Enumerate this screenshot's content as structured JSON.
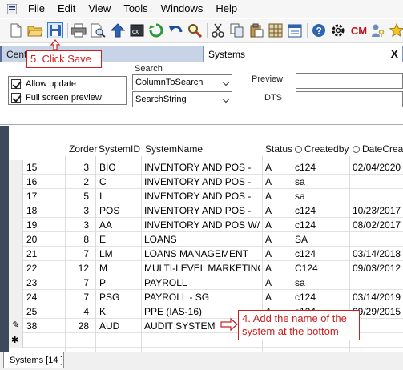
{
  "menu": {
    "items": [
      "File",
      "Edit",
      "View",
      "Tools",
      "Windows",
      "Help"
    ]
  },
  "toolbar": {
    "icons": [
      "new-file-icon",
      "open-folder-icon",
      "save-icon",
      "print-icon",
      "print-preview-icon",
      "upload-arrow-icon",
      "command-icon",
      "refresh-icon",
      "undo-icon",
      "search-zoom-icon",
      "cut-icon",
      "copy-icon",
      "paste-icon",
      "grid-icon",
      "calendar-icon",
      "help-icon",
      "settings-gear-icon",
      "cm-icon",
      "user-key-icon",
      "star-icon"
    ],
    "cm_label": "CM"
  },
  "tabs": {
    "central": "Centra",
    "systems": "Systems",
    "close_glyph": "X"
  },
  "filters": {
    "allow_update_label": "Allow update",
    "full_screen_preview_label": "Full screen preview",
    "search_label": "Search",
    "column_to_search": "ColumnToSearch",
    "search_string": "SearchString",
    "preview_label": "Preview",
    "dts_label": "DTS"
  },
  "grid": {
    "columns": [
      "Zorder",
      "SystemID",
      "SystemName",
      "Status",
      "Createdby",
      "DateCreate"
    ],
    "rows": [
      {
        "id": "15",
        "zorder": "3",
        "systemid": "BIO",
        "name": "INVENTORY AND POS -",
        "status": "A",
        "createdby": "c124",
        "date": "02/04/2020"
      },
      {
        "id": "16",
        "zorder": "2",
        "systemid": "C",
        "name": "INVENTORY AND POS -",
        "status": "A",
        "createdby": "sa",
        "date": ""
      },
      {
        "id": "17",
        "zorder": "5",
        "systemid": "I",
        "name": "INVENTORY AND POS -",
        "status": "A",
        "createdby": "sa",
        "date": ""
      },
      {
        "id": "18",
        "zorder": "3",
        "systemid": "POS",
        "name": "INVENTORY AND POS -",
        "status": "A",
        "createdby": "c124",
        "date": "10/23/2017"
      },
      {
        "id": "19",
        "zorder": "3",
        "systemid": "AA",
        "name": "INVENTORY AND POS W/",
        "status": "A",
        "createdby": "c124",
        "date": "08/02/2017"
      },
      {
        "id": "20",
        "zorder": "8",
        "systemid": "E",
        "name": "LOANS",
        "status": "A",
        "createdby": "SA",
        "date": ""
      },
      {
        "id": "21",
        "zorder": "7",
        "systemid": "LM",
        "name": "LOANS MANAGEMENT",
        "status": "A",
        "createdby": "c124",
        "date": "03/14/2018"
      },
      {
        "id": "22",
        "zorder": "12",
        "systemid": "M",
        "name": "MULTI-LEVEL MARKETING",
        "status": "A",
        "createdby": "C124",
        "date": "09/03/2012"
      },
      {
        "id": "23",
        "zorder": "7",
        "systemid": "P",
        "name": "PAYROLL",
        "status": "A",
        "createdby": "sa",
        "date": ""
      },
      {
        "id": "24",
        "zorder": "7",
        "systemid": "PSG",
        "name": "PAYROLL - SG",
        "status": "A",
        "createdby": "c124",
        "date": "03/14/2019"
      },
      {
        "id": "25",
        "zorder": "4",
        "systemid": "K",
        "name": "PPE (IAS-16)",
        "status": "A",
        "createdby": "c124",
        "date": "09/29/2015"
      },
      {
        "id": "38",
        "zorder": "28",
        "systemid": "AUD",
        "name": "AUDIT SYSTEM",
        "status": "",
        "createdby": "",
        "date": ""
      }
    ],
    "editing_glyph": "✎",
    "new_row_glyph": "✱"
  },
  "bottom_tab": "Systems [14  ]",
  "annotations": {
    "step5": "5. Click Save",
    "step4": "4. Add the name of the system at the bottom"
  },
  "colors": {
    "annotation_red": "#cc1f1f",
    "tab_strip_blue": "#5a6f93"
  }
}
